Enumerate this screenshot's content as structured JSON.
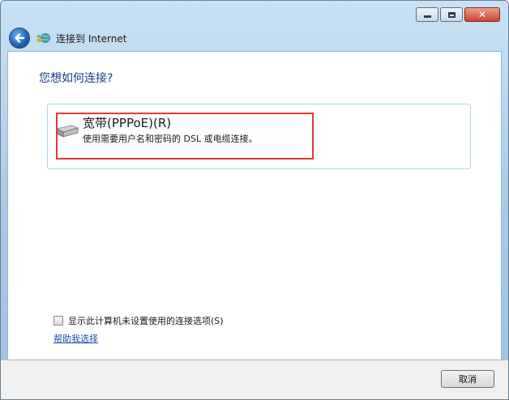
{
  "nav": {
    "title": "连接到 Internet"
  },
  "main": {
    "question": "您想如何连接?",
    "option": {
      "title": "宽带(PPPoE)(R)",
      "description": "使用需要用户名和密码的 DSL 或电缆连接。",
      "icon": "modem-icon"
    },
    "checkbox_label": "显示此计算机未设置使用的连接选项(S)",
    "help_link": "帮助我选择"
  },
  "footer": {
    "cancel_label": "取消"
  },
  "colors": {
    "accent_blue": "#1a3e8b",
    "highlight_red": "#e53935",
    "link": "#1a4fa8"
  }
}
